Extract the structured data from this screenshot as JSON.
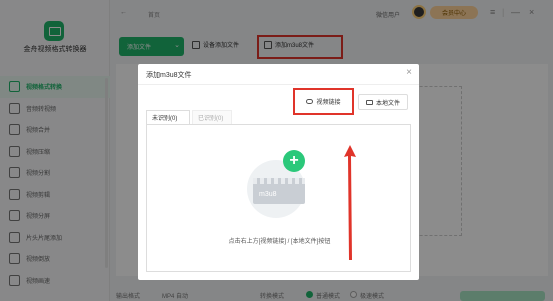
{
  "app": {
    "name": "金舟视频格式转换器"
  },
  "sidebar": {
    "items": [
      {
        "label": "视频格式转换",
        "icon": "convert-icon",
        "active": true
      },
      {
        "label": "音频转视频",
        "icon": "audio-icon"
      },
      {
        "label": "视频合并",
        "icon": "merge-icon"
      },
      {
        "label": "视频压缩",
        "icon": "compress-icon"
      },
      {
        "label": "视频分割",
        "icon": "split-icon"
      },
      {
        "label": "视频剪辑",
        "icon": "edit-icon"
      },
      {
        "label": "视频分屏",
        "icon": "splitscreen-icon"
      },
      {
        "label": "片头片尾添加",
        "icon": "intro-icon"
      },
      {
        "label": "视频倒放",
        "icon": "reverse-icon"
      },
      {
        "label": "视频画速",
        "icon": "speed-icon"
      }
    ]
  },
  "topbar": {
    "back": "←",
    "breadcrumb": "首页",
    "user": "微信用户",
    "vip": "会员中心",
    "menu": "≡",
    "minimize": "—",
    "close": "×",
    "separator": "|"
  },
  "toolbar": {
    "add_file": "添加文件",
    "add_device": "设备添加文件",
    "add_m3u8": "添加m3u8文件"
  },
  "bottombar": {
    "output_format_label": "输出格式",
    "output_format_value": "MP4 自动",
    "mode_label": "转换模式",
    "mode_normal": "普通模式",
    "mode_fast": "极速模式"
  },
  "dialog": {
    "title": "添加m3u8文件",
    "close": "×",
    "video_link": "视频链接",
    "local_file": "本地文件",
    "tab_unrecognized": "未识别(0)",
    "tab_recognized": "已识别(0)",
    "film_text": "m3u8",
    "hint": "点击右上方[视频链接] / [本地文件]按钮"
  },
  "colors": {
    "accent": "#1fb46a",
    "highlight": "#e0342a"
  }
}
